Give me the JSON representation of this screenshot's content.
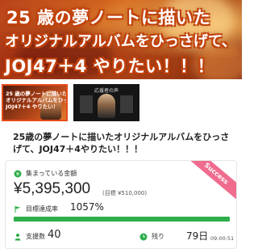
{
  "hero": {
    "line1": "25 歳の夢ノートに描いた",
    "line2": "オリジナルアルバムをひっさげて、",
    "line3": "JOJ47＋4 やりたい！！！"
  },
  "thumbs": {
    "thumb1_line1": "25 歳の夢ノートに描いた",
    "thumb1_line2": "オリジナルアルバムをひっさげて",
    "thumb1_line3": "JOJ47＋4 やりたい！",
    "thumb2_caption": "応援者の声"
  },
  "title": "25歳の夢ノートに描いたオリジナルアルバムをひっさげて、JOJ47＋4やりたい！！！",
  "stats": {
    "badge": "Success",
    "collected_label": "集まっている金額",
    "amount": "¥5,395,300",
    "target": "(目標 ¥510,000)",
    "rate_label": "目標達成率",
    "rate": "1057%",
    "rate_fraction": 1.0,
    "supporters_label": "支援数",
    "supporters": "40",
    "remaining_label": "残り",
    "remaining": "79日",
    "time": "09:00:51"
  },
  "colors": {
    "accent": "#2eae4b",
    "badge": "#ef6c8f",
    "hero_outline": "#c2410c"
  }
}
